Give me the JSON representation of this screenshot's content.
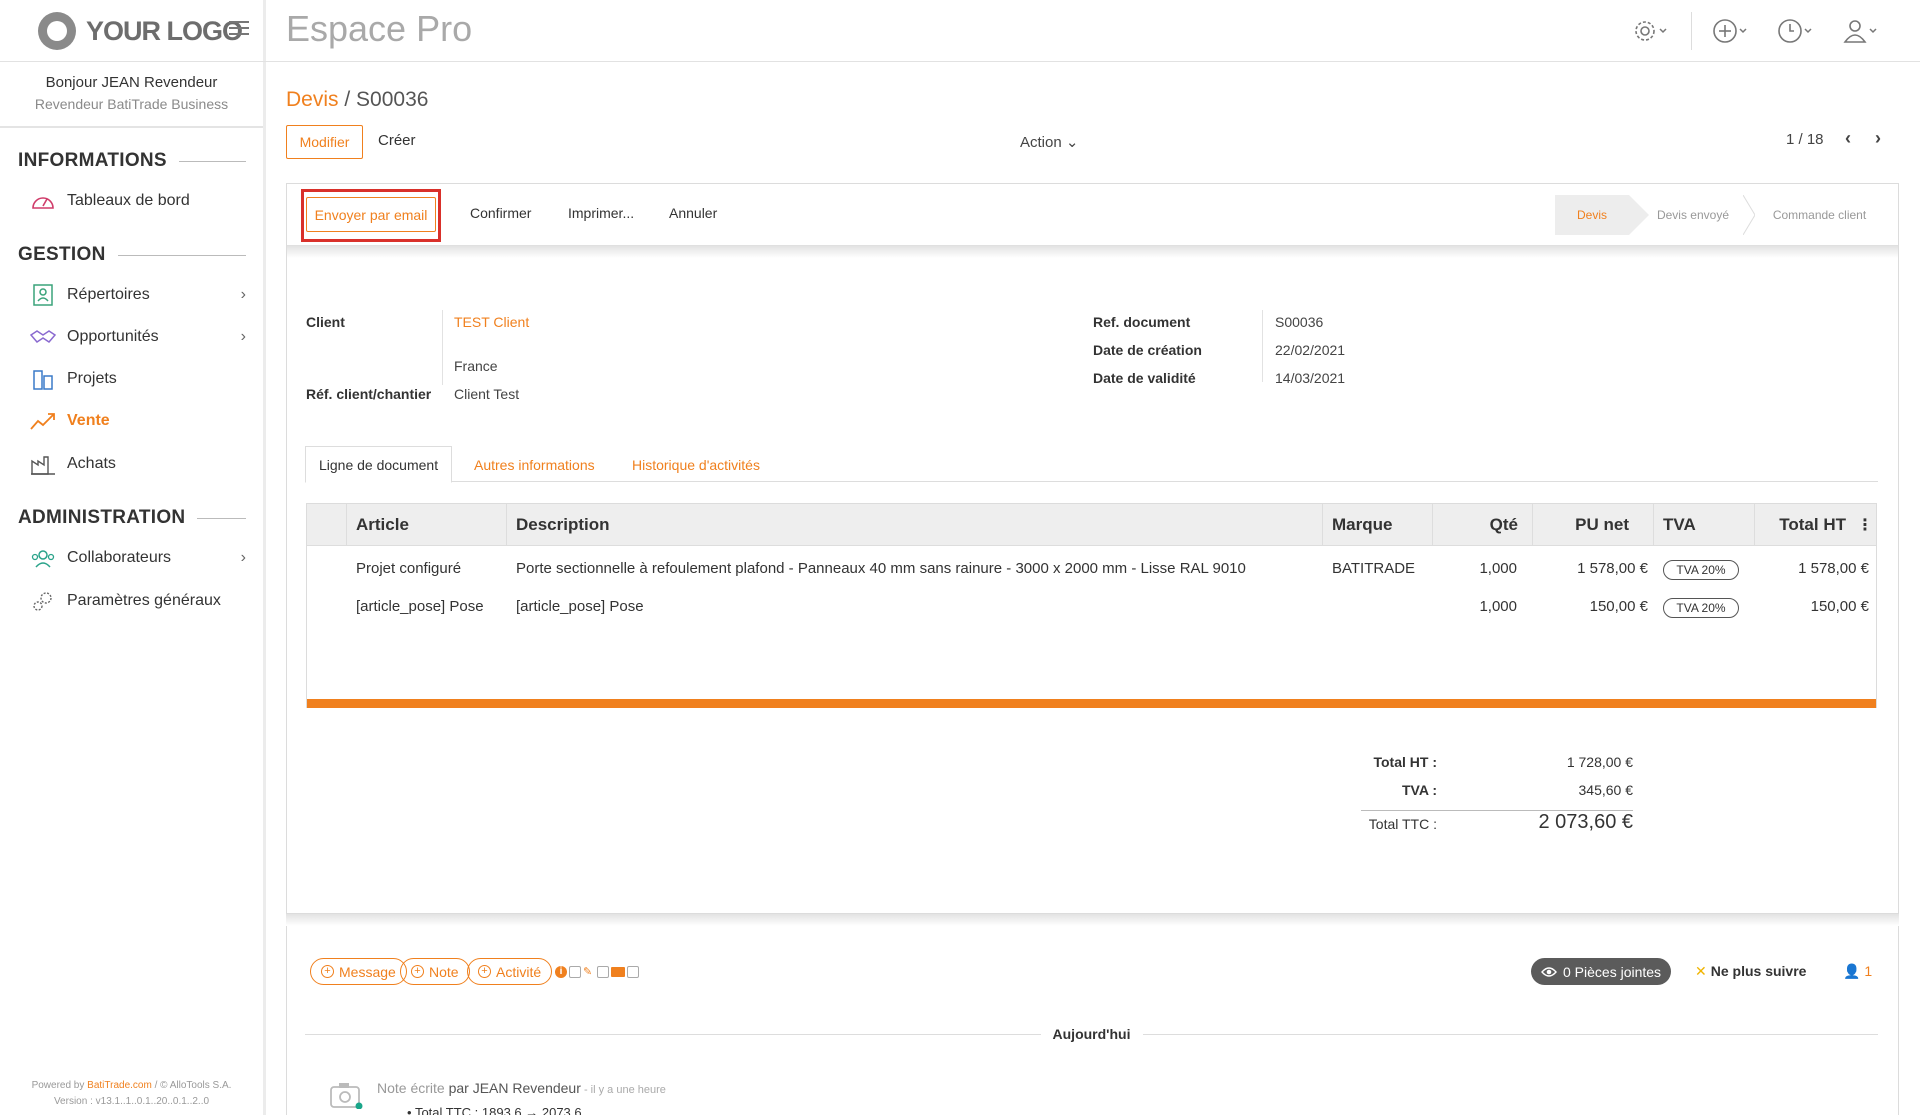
{
  "logo": {
    "text": "YOUR LOGO"
  },
  "sidebar": {
    "greeting": "Bonjour JEAN Revendeur",
    "role": "Revendeur BatiTrade Business",
    "sections": {
      "informations": "INFORMATIONS",
      "gestion": "GESTION",
      "administration": "ADMINISTRATION"
    },
    "items": {
      "tableaux": "Tableaux de bord",
      "repertoires": "Répertoires",
      "opportunites": "Opportunités",
      "projets": "Projets",
      "vente": "Vente",
      "achats": "Achats",
      "collaborateurs": "Collaborateurs",
      "parametres": "Paramètres généraux"
    },
    "powered_prefix": "Powered by ",
    "powered_brand": "BatiTrade.com",
    "powered_suffix": " / © AlloTools S.A.",
    "version": "Version : v13.1..1..0.1..20..0.1..2..0"
  },
  "header": {
    "app_title": "Espace Pro"
  },
  "breadcrumb": {
    "parent": "Devis",
    "sep": " / ",
    "current": "S00036"
  },
  "toolbar": {
    "modifier": "Modifier",
    "creer": "Créer",
    "action": "Action",
    "pager": "1 / 18"
  },
  "statusbar": {
    "envoyer": "Envoyer par email",
    "confirmer": "Confirmer",
    "imprimer": "Imprimer...",
    "annuler": "Annuler",
    "stages": [
      "Devis",
      "Devis envoyé",
      "Commande client"
    ],
    "active_stage": "Devis"
  },
  "fields": {
    "client_label": "Client",
    "client_value": "TEST Client",
    "country": "France",
    "ref_client_label": "Réf. client/chantier",
    "ref_client_value": "Client Test",
    "ref_doc_label": "Ref. document",
    "ref_doc_value": "S00036",
    "date_creation_label": "Date de création",
    "date_creation_value": "22/02/2021",
    "date_validite_label": "Date de validité",
    "date_validite_value": "14/03/2021"
  },
  "tabs": [
    "Ligne de document",
    "Autres informations",
    "Historique d'activités"
  ],
  "table": {
    "headers": [
      "Article",
      "Description",
      "Marque",
      "Qté",
      "PU net",
      "TVA",
      "Total HT"
    ],
    "rows": [
      {
        "article": "Projet configuré",
        "description": "Porte sectionnelle à refoulement plafond - Panneaux 40 mm sans rainure - 3000 x 2000 mm - Lisse RAL 9010",
        "marque": "BATITRADE",
        "qte": "1,000",
        "pu": "1 578,00 €",
        "tva": "TVA 20%",
        "total": "1 578,00 €"
      },
      {
        "article": "[article_pose] Pose",
        "description": "[article_pose] Pose",
        "marque": "",
        "qte": "1,000",
        "pu": "150,00 €",
        "tva": "TVA 20%",
        "total": "150,00 €"
      }
    ]
  },
  "totals": {
    "ht_label": "Total HT :",
    "ht_value": "1 728,00 €",
    "tva_label": "TVA :",
    "tva_value": "345,60 €",
    "ttc_label": "Total TTC :",
    "ttc_value": "2 073,60 €"
  },
  "chatter": {
    "message": "Message",
    "note": "Note",
    "activite": "Activité",
    "pieces": "0 Pièces jointes",
    "follow": "Ne plus suivre",
    "followers": "1",
    "today": "Aujourd'hui",
    "note_prefix": "Note écrite ",
    "note_author": "par JEAN Revendeur",
    "note_time": " - il y a une heure",
    "note_change": "Total TTC : 1893.6 → 2073.6"
  },
  "colors": {
    "accent": "#f0801e",
    "highlight": "#d9302a"
  }
}
